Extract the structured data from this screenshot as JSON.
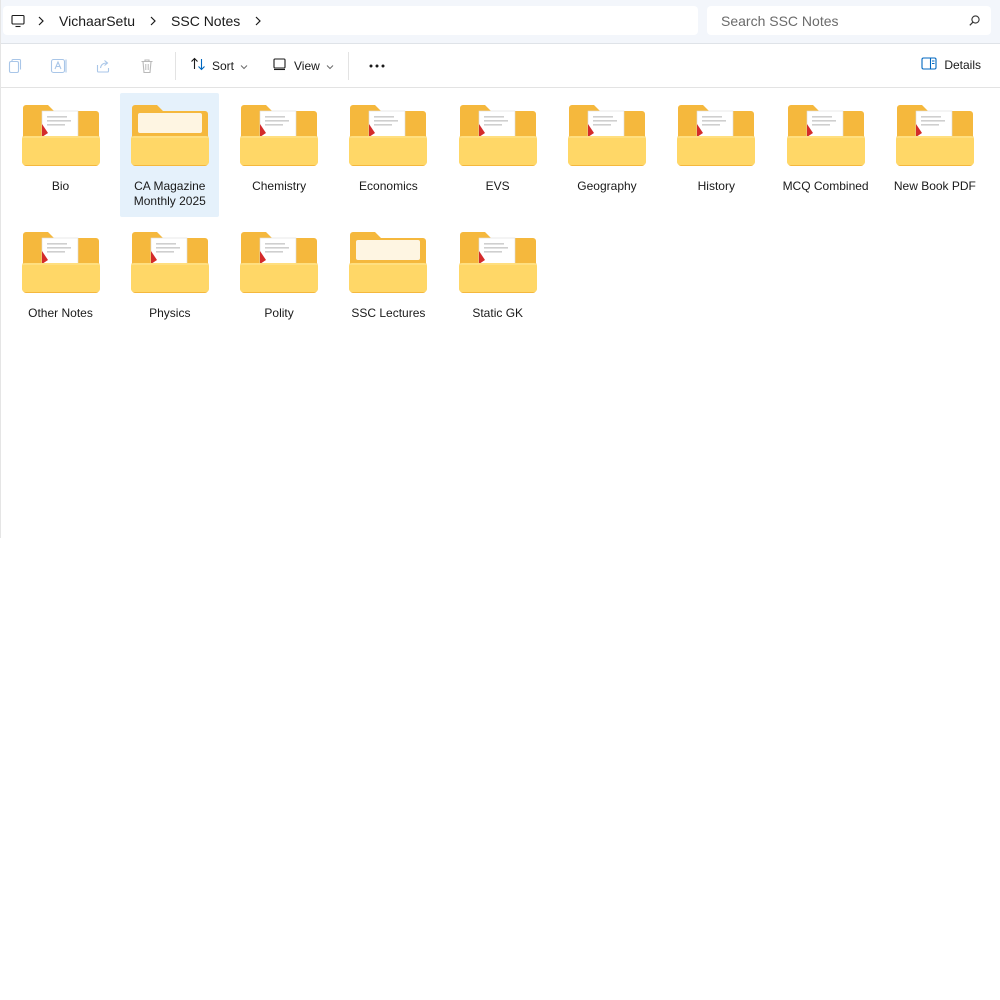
{
  "breadcrumb": {
    "items": [
      "VichaarSetu",
      "SSC Notes"
    ]
  },
  "search": {
    "placeholder": "Search SSC Notes"
  },
  "toolbar": {
    "sort_label": "Sort",
    "view_label": "View",
    "details_label": "Details"
  },
  "folders": [
    {
      "name": "Bio",
      "has_docs": true,
      "selected": false
    },
    {
      "name": "CA Magazine Monthly 2025",
      "has_docs": false,
      "selected": true
    },
    {
      "name": "Chemistry",
      "has_docs": true,
      "selected": false
    },
    {
      "name": "Economics",
      "has_docs": true,
      "selected": false
    },
    {
      "name": "EVS",
      "has_docs": true,
      "selected": false
    },
    {
      "name": "Geography",
      "has_docs": true,
      "selected": false
    },
    {
      "name": "History",
      "has_docs": true,
      "selected": false
    },
    {
      "name": "MCQ Combined",
      "has_docs": true,
      "selected": false
    },
    {
      "name": "New Book PDF",
      "has_docs": true,
      "selected": false
    },
    {
      "name": "Other Notes",
      "has_docs": true,
      "selected": false
    },
    {
      "name": "Physics",
      "has_docs": true,
      "selected": false
    },
    {
      "name": "Polity",
      "has_docs": true,
      "selected": false
    },
    {
      "name": "SSC Lectures",
      "has_docs": false,
      "selected": false
    },
    {
      "name": "Static GK",
      "has_docs": true,
      "selected": false
    }
  ],
  "colors": {
    "folder_back": "#f5b83d",
    "folder_front": "#ffd767",
    "selection": "#e5f1fb",
    "accent": "#0067c0"
  }
}
